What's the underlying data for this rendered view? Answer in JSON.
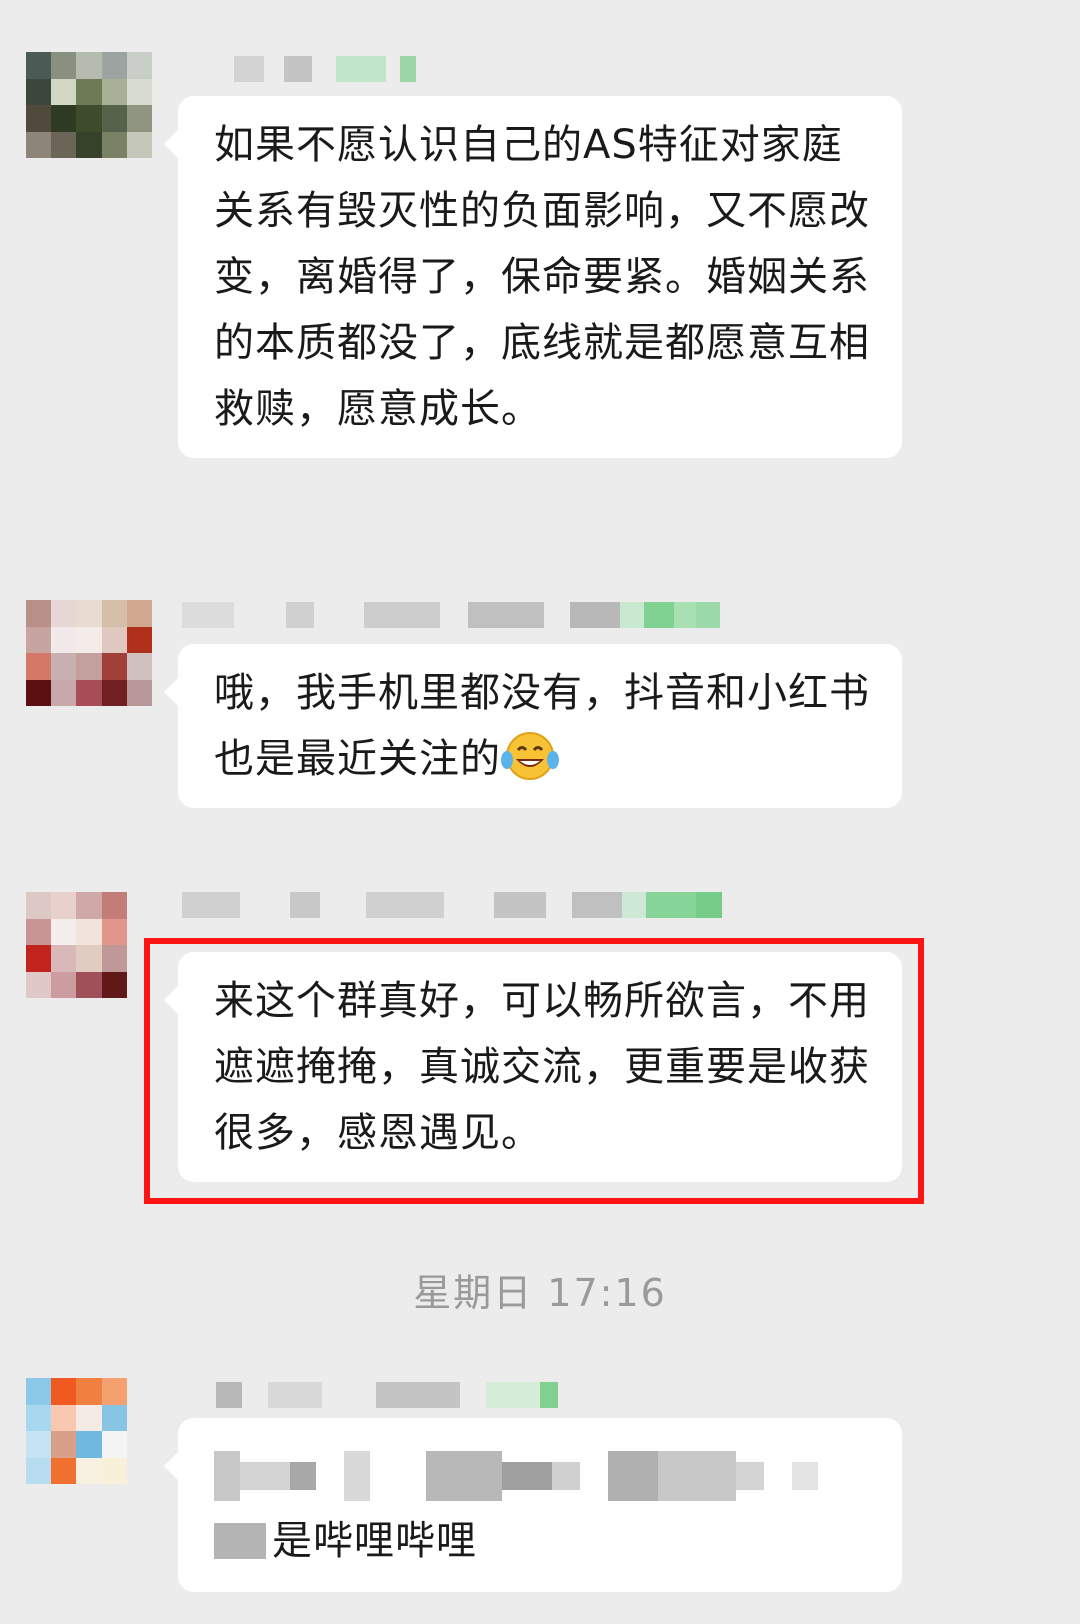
{
  "messages": [
    {
      "text": "如果不愿认识自己的AS特征对家庭关系有毁灭性的负面影响，又不愿改变，离婚得了，保命要紧。婚姻关系的本质都没了，底线就是都愿意互相救赎，愿意成长。"
    },
    {
      "text": "哦，我手机里都没有，抖音和小红书也是最近关注的",
      "emoji": "laughing-tears-emoji"
    },
    {
      "text": "来这个群真好，可以畅所欲言，不用遮遮掩掩，真诚交流，更重要是收获很多，感恩遇见。"
    },
    {
      "text_visible": "是哔哩哔哩"
    }
  ],
  "timestamp": "星期日 17:16",
  "colors": {
    "background": "#ececec",
    "bubble": "#ffffff",
    "highlight_border": "#ff1414",
    "timestamp_text": "#9a9a9a"
  }
}
